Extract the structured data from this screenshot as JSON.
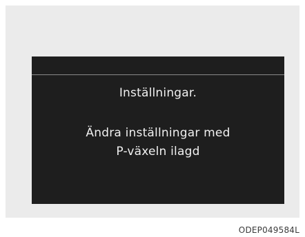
{
  "screen": {
    "title": "Inställningar.",
    "message_line1": "Ändra inställningar med",
    "message_line2": "P-växeln ilagd"
  },
  "figure_code": "ODEP049584L",
  "colors": {
    "panel_background": "#ebebeb",
    "display_background": "#1e1e1e",
    "display_text": "#f0f0f0",
    "divider": "#8a8a8a"
  }
}
